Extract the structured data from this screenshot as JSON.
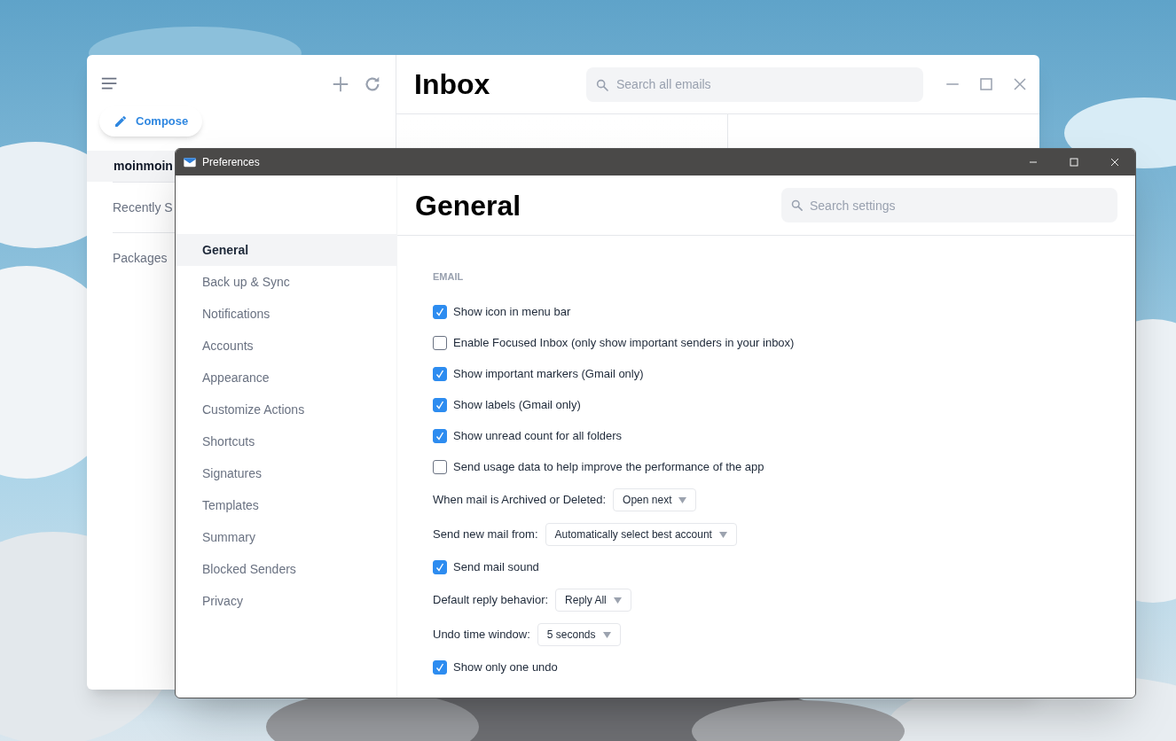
{
  "mail_window": {
    "sidebar": {
      "account": "moinmoin",
      "items": [
        {
          "label": "Recently S"
        },
        {
          "label": "Packages"
        }
      ]
    },
    "compose_button": "Compose",
    "title": "Inbox",
    "search": {
      "placeholder": "Search all emails"
    }
  },
  "preferences_window": {
    "title": "Preferences",
    "nav": [
      {
        "label": "General",
        "selected": true
      },
      {
        "label": "Back up & Sync",
        "selected": false
      },
      {
        "label": "Notifications",
        "selected": false
      },
      {
        "label": "Accounts",
        "selected": false
      },
      {
        "label": "Appearance",
        "selected": false
      },
      {
        "label": "Customize Actions",
        "selected": false
      },
      {
        "label": "Shortcuts",
        "selected": false
      },
      {
        "label": "Signatures",
        "selected": false
      },
      {
        "label": "Templates",
        "selected": false
      },
      {
        "label": "Summary",
        "selected": false
      },
      {
        "label": "Blocked Senders",
        "selected": false
      },
      {
        "label": "Privacy",
        "selected": false
      }
    ],
    "heading": "General",
    "search": {
      "placeholder": "Search settings"
    },
    "section": "EMAIL",
    "settings": [
      {
        "kind": "checkbox",
        "label": "Show icon in menu bar",
        "checked": true
      },
      {
        "kind": "checkbox",
        "label": "Enable Focused Inbox (only show important senders in your inbox)",
        "checked": false
      },
      {
        "kind": "checkbox",
        "label": "Show important markers (Gmail only)",
        "checked": true
      },
      {
        "kind": "checkbox",
        "label": "Show labels (Gmail only)",
        "checked": true
      },
      {
        "kind": "checkbox",
        "label": "Show unread count for all folders",
        "checked": true
      },
      {
        "kind": "checkbox",
        "label": "Send usage data to help improve the performance of the app",
        "checked": false
      },
      {
        "kind": "select",
        "label": "When mail is Archived or Deleted:",
        "value": "Open next"
      },
      {
        "kind": "select",
        "label": "Send new mail from:",
        "value": "Automatically select best account"
      },
      {
        "kind": "checkbox",
        "label": "Send mail sound",
        "checked": true
      },
      {
        "kind": "select",
        "label": "Default reply behavior:",
        "value": "Reply All"
      },
      {
        "kind": "select",
        "label": "Undo time window:",
        "value": "5 seconds"
      },
      {
        "kind": "checkbox",
        "label": "Show only one undo",
        "checked": true
      }
    ]
  }
}
